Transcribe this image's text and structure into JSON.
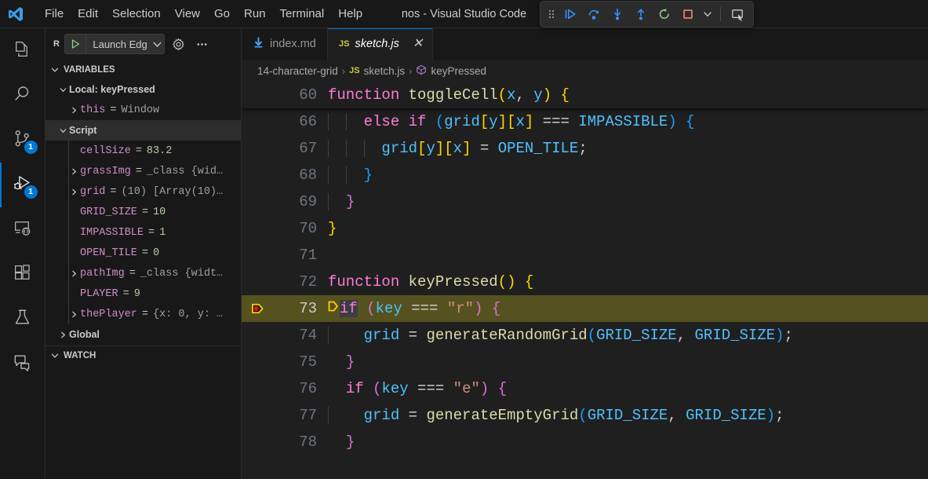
{
  "window": {
    "title": "nos - Visual Studio Code",
    "logo": "vscode-logo"
  },
  "menubar": {
    "items": [
      {
        "label": "File"
      },
      {
        "label": "Edit"
      },
      {
        "label": "Selection"
      },
      {
        "label": "View"
      },
      {
        "label": "Go"
      },
      {
        "label": "Run"
      },
      {
        "label": "Terminal"
      },
      {
        "label": "Help"
      }
    ]
  },
  "debug_toolbar": {
    "grip": "drag-handle-icon",
    "buttons": [
      {
        "name": "continue-button",
        "icon": "continue-icon",
        "color": "#3794ff"
      },
      {
        "name": "step-over-button",
        "icon": "step-over-icon",
        "color": "#3794ff"
      },
      {
        "name": "step-into-button",
        "icon": "step-into-icon",
        "color": "#3794ff"
      },
      {
        "name": "step-out-button",
        "icon": "step-out-icon",
        "color": "#3794ff"
      },
      {
        "name": "restart-button",
        "icon": "restart-icon",
        "color": "#89d185"
      },
      {
        "name": "stop-button",
        "icon": "stop-icon",
        "color": "#f48771"
      }
    ],
    "dropdown": "chevron-down-icon",
    "focus_button": "focus-session-icon"
  },
  "activitybar": {
    "items": [
      {
        "name": "explorer",
        "icon": "files-icon",
        "badge": "",
        "active": false
      },
      {
        "name": "search",
        "icon": "search-icon",
        "badge": "",
        "active": false
      },
      {
        "name": "source-control",
        "icon": "source-control-icon",
        "badge": "1",
        "active": false
      },
      {
        "name": "run-and-debug",
        "icon": "run-and-debug-icon",
        "badge": "1",
        "active": true
      },
      {
        "name": "remote",
        "icon": "remote-explorer-icon",
        "badge": "",
        "active": false
      },
      {
        "name": "extensions",
        "icon": "extensions-icon",
        "badge": "",
        "active": false
      },
      {
        "name": "testing",
        "icon": "beaker-icon",
        "badge": "",
        "active": false
      },
      {
        "name": "chat",
        "icon": "chat-icon",
        "badge": "",
        "active": false
      }
    ]
  },
  "sidebar": {
    "title": "R",
    "launch_config": {
      "label": "Launch Edg",
      "play_icon": "play-icon",
      "chevron": "chevron-down-icon"
    },
    "gear_icon": "gear-icon",
    "more_icon": "ellipsis-icon",
    "sections": [
      {
        "label": "VARIABLES",
        "expanded": true
      },
      {
        "label": "WATCH",
        "expanded": true
      }
    ],
    "variables": [
      {
        "kind": "scope-local",
        "label": "Local: keyPressed",
        "expandable": true,
        "expanded": true,
        "indent": 1
      },
      {
        "kind": "var",
        "name": "this",
        "value": "Window",
        "vtype": "obj",
        "expandable": true,
        "indent": 2
      },
      {
        "kind": "scope",
        "label": "Script",
        "expandable": true,
        "expanded": true,
        "indent": 1
      },
      {
        "kind": "var",
        "name": "cellSize",
        "value": "83.2",
        "vtype": "num",
        "expandable": false,
        "indent": 2
      },
      {
        "kind": "var",
        "name": "grassImg",
        "value": "_class {wid…",
        "vtype": "obj",
        "expandable": true,
        "indent": 2
      },
      {
        "kind": "var",
        "name": "grid",
        "value": "(10) [Array(10)…",
        "vtype": "obj",
        "expandable": true,
        "indent": 2
      },
      {
        "kind": "var",
        "name": "GRID_SIZE",
        "value": "10",
        "vtype": "num",
        "expandable": false,
        "indent": 2
      },
      {
        "kind": "var",
        "name": "IMPASSIBLE",
        "value": "1",
        "vtype": "num",
        "expandable": false,
        "indent": 2
      },
      {
        "kind": "var",
        "name": "OPEN_TILE",
        "value": "0",
        "vtype": "num",
        "expandable": false,
        "indent": 2
      },
      {
        "kind": "var",
        "name": "pathImg",
        "value": "_class {widt…",
        "vtype": "obj",
        "expandable": true,
        "indent": 2
      },
      {
        "kind": "var",
        "name": "PLAYER",
        "value": "9",
        "vtype": "num",
        "expandable": false,
        "indent": 2
      },
      {
        "kind": "var",
        "name": "thePlayer",
        "value": "{x: 0, y: …",
        "vtype": "obj",
        "expandable": true,
        "indent": 2
      },
      {
        "kind": "scope-plain",
        "label": "Global",
        "expandable": true,
        "expanded": false,
        "indent": 1
      }
    ]
  },
  "editor": {
    "tabs": [
      {
        "label": "index.md",
        "icon": "markdown-icon",
        "active": false,
        "closable": false
      },
      {
        "label": "sketch.js",
        "icon": "javascript-icon",
        "active": true,
        "closable": true,
        "close_icon": "close-icon"
      }
    ],
    "breadcrumb": [
      {
        "label": "14-character-grid",
        "icon": ""
      },
      {
        "label": "sketch.js",
        "icon": "javascript-icon"
      },
      {
        "label": "keyPressed",
        "icon": "symbol-method-icon"
      }
    ],
    "sticky_line": {
      "number": "60",
      "tokens": [
        {
          "t": "function ",
          "c": "kw"
        },
        {
          "t": "toggleCell",
          "c": "fn"
        },
        {
          "t": "(",
          "c": "b1"
        },
        {
          "t": "x",
          "c": "var"
        },
        {
          "t": ", ",
          "c": "plain"
        },
        {
          "t": "y",
          "c": "var"
        },
        {
          "t": ")",
          "c": "b1"
        },
        {
          "t": " ",
          "c": "plain"
        },
        {
          "t": "{",
          "c": "b1"
        }
      ]
    },
    "lines": [
      {
        "number": "66",
        "indent_guides": 2,
        "highlight": false,
        "breakpoint": false,
        "tokens": [
          {
            "t": "    ",
            "c": "plain"
          },
          {
            "t": "else if",
            "c": "kw"
          },
          {
            "t": " ",
            "c": "plain"
          },
          {
            "t": "(",
            "c": "b3"
          },
          {
            "t": "grid",
            "c": "var"
          },
          {
            "t": "[",
            "c": "b1"
          },
          {
            "t": "y",
            "c": "var"
          },
          {
            "t": "]",
            "c": "b1"
          },
          {
            "t": "[",
            "c": "b1"
          },
          {
            "t": "x",
            "c": "var"
          },
          {
            "t": "]",
            "c": "b1"
          },
          {
            "t": " === ",
            "c": "op"
          },
          {
            "t": "IMPASSIBLE",
            "c": "const"
          },
          {
            "t": ")",
            "c": "b3"
          },
          {
            "t": " ",
            "c": "plain"
          },
          {
            "t": "{",
            "c": "b3"
          }
        ]
      },
      {
        "number": "67",
        "indent_guides": 3,
        "highlight": false,
        "breakpoint": false,
        "tokens": [
          {
            "t": "      ",
            "c": "plain"
          },
          {
            "t": "grid",
            "c": "var"
          },
          {
            "t": "[",
            "c": "b1"
          },
          {
            "t": "y",
            "c": "var"
          },
          {
            "t": "]",
            "c": "b1"
          },
          {
            "t": "[",
            "c": "b1"
          },
          {
            "t": "x",
            "c": "var"
          },
          {
            "t": "]",
            "c": "b1"
          },
          {
            "t": " = ",
            "c": "op"
          },
          {
            "t": "OPEN_TILE",
            "c": "const"
          },
          {
            "t": ";",
            "c": "plain"
          }
        ]
      },
      {
        "number": "68",
        "indent_guides": 2,
        "highlight": false,
        "breakpoint": false,
        "tokens": [
          {
            "t": "    ",
            "c": "plain"
          },
          {
            "t": "}",
            "c": "b3"
          }
        ]
      },
      {
        "number": "69",
        "indent_guides": 1,
        "highlight": false,
        "breakpoint": false,
        "tokens": [
          {
            "t": "  ",
            "c": "plain"
          },
          {
            "t": "}",
            "c": "b2"
          }
        ]
      },
      {
        "number": "70",
        "indent_guides": 0,
        "highlight": false,
        "breakpoint": false,
        "tokens": [
          {
            "t": "}",
            "c": "b1"
          }
        ]
      },
      {
        "number": "71",
        "indent_guides": 0,
        "highlight": false,
        "breakpoint": false,
        "tokens": []
      },
      {
        "number": "72",
        "indent_guides": 0,
        "highlight": false,
        "breakpoint": false,
        "tokens": [
          {
            "t": "function ",
            "c": "kw"
          },
          {
            "t": "keyPressed",
            "c": "fn"
          },
          {
            "t": "(",
            "c": "b1"
          },
          {
            "t": ")",
            "c": "b1"
          },
          {
            "t": " ",
            "c": "plain"
          },
          {
            "t": "{",
            "c": "b1"
          }
        ]
      },
      {
        "number": "73",
        "indent_guides": 0,
        "highlight": true,
        "breakpoint": true,
        "debug_arrow": true,
        "tokens": [
          {
            "t": "if",
            "c": "kw",
            "sel": true
          },
          {
            "t": " ",
            "c": "plain"
          },
          {
            "t": "(",
            "c": "b2"
          },
          {
            "t": "key",
            "c": "var"
          },
          {
            "t": " === ",
            "c": "op"
          },
          {
            "t": "\"r\"",
            "c": "str"
          },
          {
            "t": ")",
            "c": "b2"
          },
          {
            "t": " ",
            "c": "plain"
          },
          {
            "t": "{",
            "c": "b2"
          }
        ]
      },
      {
        "number": "74",
        "indent_guides": 1,
        "highlight": false,
        "breakpoint": false,
        "tokens": [
          {
            "t": "    ",
            "c": "plain"
          },
          {
            "t": "grid",
            "c": "var"
          },
          {
            "t": " = ",
            "c": "op"
          },
          {
            "t": "generateRandomGrid",
            "c": "fn"
          },
          {
            "t": "(",
            "c": "b3"
          },
          {
            "t": "GRID_SIZE",
            "c": "const"
          },
          {
            "t": ", ",
            "c": "plain"
          },
          {
            "t": "GRID_SIZE",
            "c": "const"
          },
          {
            "t": ")",
            "c": "b3"
          },
          {
            "t": ";",
            "c": "plain"
          }
        ]
      },
      {
        "number": "75",
        "indent_guides": 0,
        "highlight": false,
        "breakpoint": false,
        "tokens": [
          {
            "t": "  ",
            "c": "plain"
          },
          {
            "t": "}",
            "c": "b2"
          }
        ]
      },
      {
        "number": "76",
        "indent_guides": 0,
        "highlight": false,
        "breakpoint": false,
        "tokens": [
          {
            "t": "  ",
            "c": "plain"
          },
          {
            "t": "if",
            "c": "kw"
          },
          {
            "t": " ",
            "c": "plain"
          },
          {
            "t": "(",
            "c": "b2"
          },
          {
            "t": "key",
            "c": "var"
          },
          {
            "t": " === ",
            "c": "op"
          },
          {
            "t": "\"e\"",
            "c": "str"
          },
          {
            "t": ")",
            "c": "b2"
          },
          {
            "t": " ",
            "c": "plain"
          },
          {
            "t": "{",
            "c": "b2"
          }
        ]
      },
      {
        "number": "77",
        "indent_guides": 1,
        "highlight": false,
        "breakpoint": false,
        "tokens": [
          {
            "t": "    ",
            "c": "plain"
          },
          {
            "t": "grid",
            "c": "var"
          },
          {
            "t": " = ",
            "c": "op"
          },
          {
            "t": "generateEmptyGrid",
            "c": "fn"
          },
          {
            "t": "(",
            "c": "b3"
          },
          {
            "t": "GRID_SIZE",
            "c": "const"
          },
          {
            "t": ", ",
            "c": "plain"
          },
          {
            "t": "GRID_SIZE",
            "c": "const"
          },
          {
            "t": ")",
            "c": "b3"
          },
          {
            "t": ";",
            "c": "plain"
          }
        ]
      },
      {
        "number": "78",
        "indent_guides": 0,
        "highlight": false,
        "breakpoint": false,
        "tokens": [
          {
            "t": "  ",
            "c": "plain"
          },
          {
            "t": "}",
            "c": "b2"
          }
        ]
      }
    ]
  },
  "colors": {
    "accent": "#0078d4",
    "titlebar_bg": "#181818",
    "editor_bg": "#1f1f1f",
    "sidebar_bg": "#181818",
    "debug_line_highlight": "#55521f",
    "badge_bg": "#0078d4",
    "stop_icon": "#f48771",
    "restart_icon": "#89d185",
    "js_badge": "#cbcb41",
    "breakpoint": "#e51400"
  }
}
